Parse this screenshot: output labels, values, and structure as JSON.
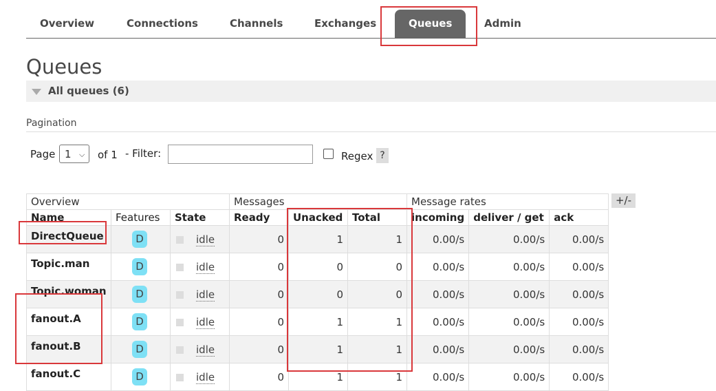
{
  "nav": {
    "tabs": [
      {
        "label": "Overview",
        "active": false
      },
      {
        "label": "Connections",
        "active": false
      },
      {
        "label": "Channels",
        "active": false
      },
      {
        "label": "Exchanges",
        "active": false
      },
      {
        "label": "Queues",
        "active": true
      },
      {
        "label": "Admin",
        "active": false
      }
    ]
  },
  "page": {
    "title": "Queues",
    "section_label": "All queues (6)",
    "pagination_label": "Pagination"
  },
  "pagination": {
    "page_label": "Page",
    "page_value": "1",
    "of_label": "of 1",
    "filter_label": "- Filter:",
    "filter_value": "",
    "regex_label": "Regex",
    "help_label": "?"
  },
  "table": {
    "groups": [
      "Overview",
      "Messages",
      "Message rates"
    ],
    "columns": [
      "Name",
      "Features",
      "State",
      "Ready",
      "Unacked",
      "Total",
      "incoming",
      "deliver / get",
      "ack"
    ],
    "toggle_label": "+/-",
    "rows": [
      {
        "name": "DirectQueue",
        "feature": "D",
        "state": "idle",
        "ready": "0",
        "unacked": "1",
        "total": "1",
        "incoming": "0.00/s",
        "deliver_get": "0.00/s",
        "ack": "0.00/s"
      },
      {
        "name": "Topic.man",
        "feature": "D",
        "state": "idle",
        "ready": "0",
        "unacked": "0",
        "total": "0",
        "incoming": "0.00/s",
        "deliver_get": "0.00/s",
        "ack": "0.00/s"
      },
      {
        "name": "Topic.woman",
        "feature": "D",
        "state": "idle",
        "ready": "0",
        "unacked": "0",
        "total": "0",
        "incoming": "0.00/s",
        "deliver_get": "0.00/s",
        "ack": "0.00/s"
      },
      {
        "name": "fanout.A",
        "feature": "D",
        "state": "idle",
        "ready": "0",
        "unacked": "1",
        "total": "1",
        "incoming": "0.00/s",
        "deliver_get": "0.00/s",
        "ack": "0.00/s"
      },
      {
        "name": "fanout.B",
        "feature": "D",
        "state": "idle",
        "ready": "0",
        "unacked": "1",
        "total": "1",
        "incoming": "0.00/s",
        "deliver_get": "0.00/s",
        "ack": "0.00/s"
      },
      {
        "name": "fanout.C",
        "feature": "D",
        "state": "idle",
        "ready": "0",
        "unacked": "1",
        "total": "1",
        "incoming": "0.00/s",
        "deliver_get": "0.00/s",
        "ack": "0.00/s"
      }
    ]
  },
  "colors": {
    "active_tab": "#666666",
    "feature_badge": "#7ee0f5",
    "annotation": "#d9373a"
  }
}
